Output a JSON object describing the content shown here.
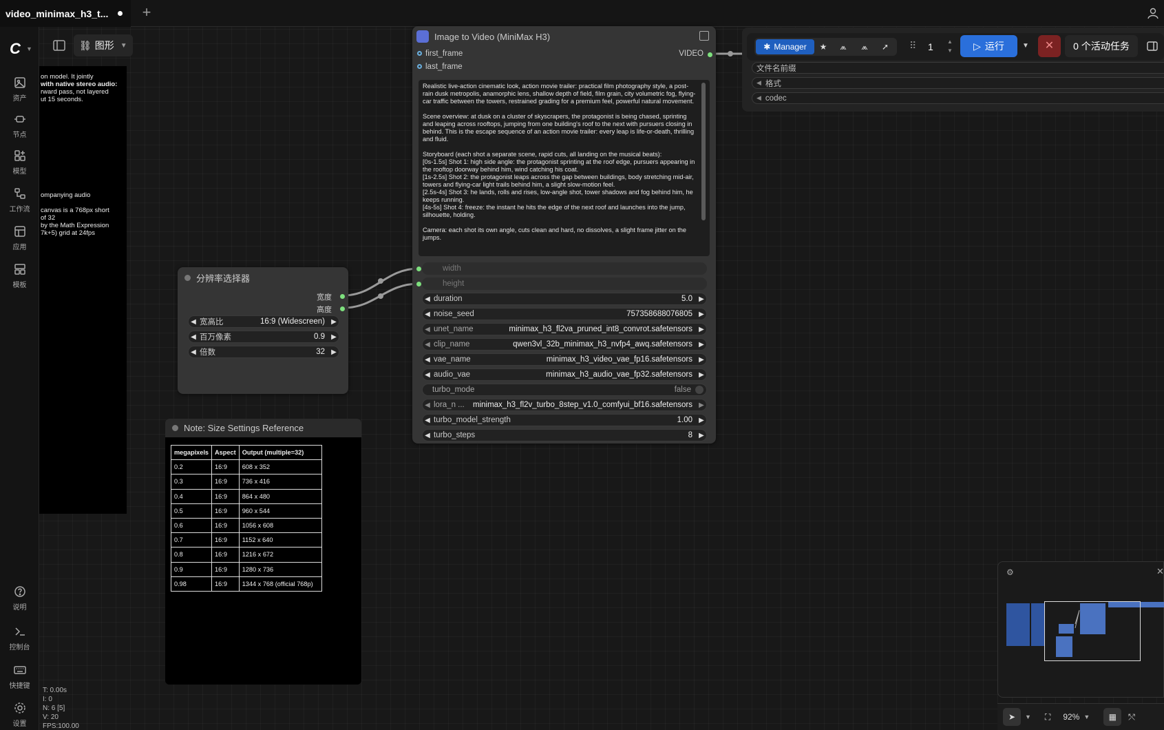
{
  "tab": {
    "title": "video_minimax_h3_t...",
    "new_tab": "+"
  },
  "sidebar": {
    "items": [
      {
        "label": "资产",
        "icon": "image-icon"
      },
      {
        "label": "节点",
        "icon": "node-icon"
      },
      {
        "label": "模型",
        "icon": "model-icon"
      },
      {
        "label": "工作流",
        "icon": "workflow-icon"
      },
      {
        "label": "应用",
        "icon": "app-icon"
      },
      {
        "label": "模板",
        "icon": "template-icon"
      }
    ],
    "bottom_items": [
      {
        "label": "说明",
        "icon": "help-icon"
      },
      {
        "label": "控制台",
        "icon": "console-icon"
      },
      {
        "label": "快捷键",
        "icon": "keyboard-icon"
      },
      {
        "label": "设置",
        "icon": "gear-icon"
      }
    ]
  },
  "view": {
    "graph_label": "图形"
  },
  "left_note": {
    "lines": [
      "on model. It jointly",
      "with native stereo audio:",
      "rward pass, not layered",
      "ut 15 seconds.",
      "ompanying audio",
      "canvas is a 768px short",
      "of 32",
      "by the Math Expression",
      "7k+5) grid at 24fps"
    ]
  },
  "main_node": {
    "title": "Image to Video (MiniMax H3)",
    "inputs": [
      "first_frame",
      "last_frame"
    ],
    "output": "VIDEO",
    "prompt": [
      "Realistic live-action cinematic look, action movie trailer: practical film photography style, a post-rain dusk metropolis, anamorphic lens, shallow depth of field, film grain, city volumetric fog, flying-car traffic between the towers, restrained grading for a premium feel, powerful natural movement.",
      "Scene overview: at dusk on a cluster of skyscrapers, the protagonist is being chased, sprinting and leaping across rooftops, jumping from one building's roof to the next with pursuers closing in behind. This is the escape sequence of an action movie trailer: every leap is life-or-death, thrilling and fluid.",
      "Storyboard (each shot a separate scene, rapid cuts, all landing on the musical beats):\n[0s-1.5s] Shot 1: high side angle: the protagonist sprinting at the roof edge, pursuers appearing in the rooftop doorway behind him, wind catching his coat.\n[1s-2.5s] Shot 2: the protagonist leaps across the gap between buildings, body stretching mid-air, towers and flying-car light trails behind him, a slight slow-motion feel.\n[2.5s-4s] Shot 3: he lands, rolls and rises, low-angle shot, tower shadows and fog behind him, he keeps running.\n[4s-5s] Shot 4: freeze: the instant he hits the edge of the next roof and launches into the jump, silhouette, holding.",
      "Camera: each shot its own angle, cuts clean and hard, no dissolves, a slight frame jitter on the jumps."
    ],
    "dim_inputs": [
      "width",
      "height"
    ],
    "widgets": [
      {
        "label": "duration",
        "value": "5.0"
      },
      {
        "label": "noise_seed",
        "value": "757358688076805"
      },
      {
        "label": "unet_name",
        "value": "minimax_h3_fl2va_pruned_int8_convrot.safetensors"
      },
      {
        "label": "clip_name",
        "value": "qwen3vl_32b_minimax_h3_nvfp4_awq.safetensors"
      },
      {
        "label": "vae_name",
        "value": "minimax_h3_video_vae_fp16.safetensors"
      },
      {
        "label": "audio_vae",
        "value": "minimax_h3_audio_vae_fp32.safetensors"
      },
      {
        "label": "turbo_mode",
        "value": "false"
      },
      {
        "label": "lora_n ...",
        "value": "minimax_h3_fl2v_turbo_8step_v1.0_comfyui_bf16.safetensors"
      },
      {
        "label": "turbo_model_strength",
        "value": "1.00"
      },
      {
        "label": "turbo_steps",
        "value": "8"
      }
    ]
  },
  "res_node": {
    "title": "分辨率选择器",
    "outputs": [
      "宽度",
      "高度"
    ],
    "widgets": [
      {
        "label": "宽高比",
        "value": "16:9 (Widescreen)"
      },
      {
        "label": "百万像素",
        "value": "0.9"
      },
      {
        "label": "倍数",
        "value": "32"
      }
    ]
  },
  "size_note": {
    "title": "Note: Size Settings Reference",
    "headers": [
      "megapixels",
      "Aspect",
      "Output (multiple=32)"
    ],
    "rows": [
      [
        "0.2",
        "16:9",
        "608 x 352"
      ],
      [
        "0.3",
        "16:9",
        "736 x 416"
      ],
      [
        "0.4",
        "16:9",
        "864 x 480"
      ],
      [
        "0.5",
        "16:9",
        "960 x 544"
      ],
      [
        "0.6",
        "16:9",
        "1056 x 608"
      ],
      [
        "0.7",
        "16:9",
        "1152 x 640"
      ],
      [
        "0.8",
        "16:9",
        "1216 x 672"
      ],
      [
        "0.9",
        "16:9",
        "1280 x 736"
      ],
      [
        "0.98",
        "16:9",
        "1344 x 768 (official 768p)"
      ]
    ]
  },
  "save_node": {
    "widgets": [
      "文件名前缀",
      "格式",
      "codec"
    ]
  },
  "toolbar": {
    "manager": "Manager",
    "queue_count": "1",
    "run": "运行",
    "active_tasks": "0 个活动任务"
  },
  "bottom": {
    "zoom": "92%"
  },
  "stats": [
    "T: 0.00s",
    "I: 0",
    "N: 6 [5]",
    "V: 20",
    "FPS:100.00"
  ],
  "colors": {
    "accent": "#2a6fdb",
    "link": "#7ee07e",
    "canvas": "#181818"
  }
}
